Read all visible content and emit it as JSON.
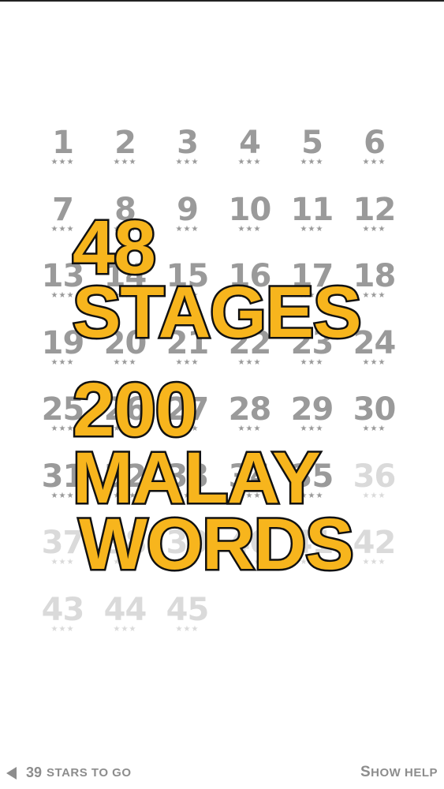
{
  "stages": [
    {
      "number": "1",
      "stars": "★★★",
      "locked": false
    },
    {
      "number": "2",
      "stars": "★★★",
      "locked": false
    },
    {
      "number": "3",
      "stars": "★★★",
      "locked": false
    },
    {
      "number": "4",
      "stars": "★★★",
      "locked": false
    },
    {
      "number": "5",
      "stars": "★★★",
      "locked": false
    },
    {
      "number": "6",
      "stars": "★★★",
      "locked": false
    },
    {
      "number": "7",
      "stars": "★★★",
      "locked": false
    },
    {
      "number": "8",
      "stars": "★★★",
      "locked": false
    },
    {
      "number": "9",
      "stars": "★★★",
      "locked": false
    },
    {
      "number": "10",
      "stars": "★★★",
      "locked": false
    },
    {
      "number": "11",
      "stars": "★★★",
      "locked": false
    },
    {
      "number": "12",
      "stars": "★★★",
      "locked": false
    },
    {
      "number": "13",
      "stars": "★★★",
      "locked": false
    },
    {
      "number": "14",
      "stars": "★★★",
      "locked": false
    },
    {
      "number": "15",
      "stars": "★★★",
      "locked": false
    },
    {
      "number": "16",
      "stars": "★★★",
      "locked": false
    },
    {
      "number": "17",
      "stars": "★★★",
      "locked": false
    },
    {
      "number": "18",
      "stars": "★★★",
      "locked": false
    },
    {
      "number": "19",
      "stars": "★★★",
      "locked": false
    },
    {
      "number": "20",
      "stars": "★★★",
      "locked": false
    },
    {
      "number": "21",
      "stars": "★★★",
      "locked": false
    },
    {
      "number": "22",
      "stars": "★★★",
      "locked": false
    },
    {
      "number": "23",
      "stars": "★★★",
      "locked": false
    },
    {
      "number": "24",
      "stars": "★★★",
      "locked": false
    },
    {
      "number": "25",
      "stars": "★★★",
      "locked": false
    },
    {
      "number": "26",
      "stars": "★★★",
      "locked": false
    },
    {
      "number": "27",
      "stars": "★★★",
      "locked": false
    },
    {
      "number": "28",
      "stars": "★★★",
      "locked": false
    },
    {
      "number": "29",
      "stars": "★★★",
      "locked": false
    },
    {
      "number": "30",
      "stars": "★★★",
      "locked": false
    },
    {
      "number": "31",
      "stars": "★★★",
      "locked": false
    },
    {
      "number": "32",
      "stars": "★★★",
      "locked": false
    },
    {
      "number": "33",
      "stars": "★★★",
      "locked": false
    },
    {
      "number": "34",
      "stars": "★★★",
      "locked": false
    },
    {
      "number": "35",
      "stars": "★★★",
      "locked": false
    },
    {
      "number": "36",
      "stars": "★★★",
      "locked": true
    },
    {
      "number": "37",
      "stars": "★★★",
      "locked": true
    },
    {
      "number": "38",
      "stars": "★★★",
      "locked": true
    },
    {
      "number": "39",
      "stars": "★★★",
      "locked": true
    },
    {
      "number": "40",
      "stars": "★★★",
      "locked": true
    },
    {
      "number": "41",
      "stars": "★★★",
      "locked": true
    },
    {
      "number": "42",
      "stars": "★★★",
      "locked": true
    },
    {
      "number": "43",
      "stars": "★★★",
      "locked": true
    },
    {
      "number": "44",
      "stars": "★★★",
      "locked": true
    },
    {
      "number": "45",
      "stars": "★★★",
      "locked": true
    }
  ],
  "promo": {
    "line1": "48",
    "line2": "STAGES",
    "line3": "200",
    "line4": "MALAY",
    "line5": "WORDS"
  },
  "footer": {
    "back_icon": "triangle-left-icon",
    "stars_count": "39",
    "stars_label": "STARS TO GO",
    "help_first": "S",
    "help_rest": "HOW HELP"
  },
  "colors": {
    "stage_unlocked": "#9a9a9a",
    "stage_locked": "#dadada",
    "promo_fill": "#f7b51d",
    "promo_outline": "#111111",
    "footer_text": "#8d8d8d"
  }
}
